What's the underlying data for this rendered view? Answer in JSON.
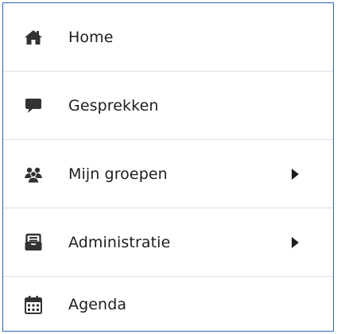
{
  "menu": {
    "items": [
      {
        "label": "Home",
        "icon": "home-icon"
      },
      {
        "label": "Gesprekken",
        "icon": "chat-bubble-icon"
      },
      {
        "label": "Mijn groepen",
        "icon": "users-group-icon",
        "has_submenu": true
      },
      {
        "label": "Administratie",
        "icon": "inbox-tray-icon",
        "has_submenu": true
      },
      {
        "label": "Agenda",
        "icon": "calendar-icon"
      }
    ]
  },
  "colors": {
    "border": "#2f63a8",
    "icon": "#333333",
    "text": "#1d1d1d",
    "divider": "#dcdcdc"
  }
}
